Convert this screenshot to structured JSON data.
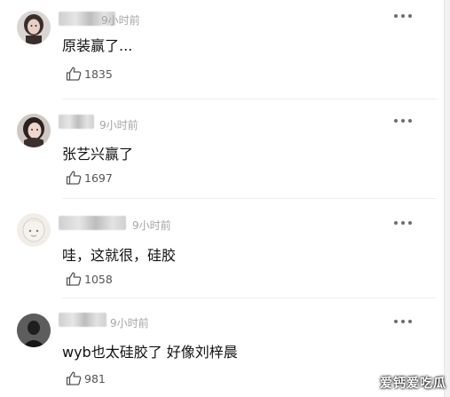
{
  "comments": [
    {
      "time": "9小时前",
      "text": "原装赢了...",
      "likes": "1835",
      "avatar": "woman-avatar-icon"
    },
    {
      "time": "9小时前",
      "text": "张艺兴赢了",
      "likes": "1697",
      "avatar": "woman-avatar-icon"
    },
    {
      "time": "9小时前",
      "text": "哇，这就很，硅胶",
      "likes": "1058",
      "avatar": "cartoon-avatar-icon"
    },
    {
      "time": "9小时前",
      "text": "wyb也太硅胶了 好像刘梓晨",
      "likes": "981",
      "avatar": "dark-avatar-icon"
    }
  ],
  "icons": {
    "more": "more-options-icon",
    "like": "thumbs-up-icon"
  },
  "watermark": "爱钙爱吃瓜"
}
